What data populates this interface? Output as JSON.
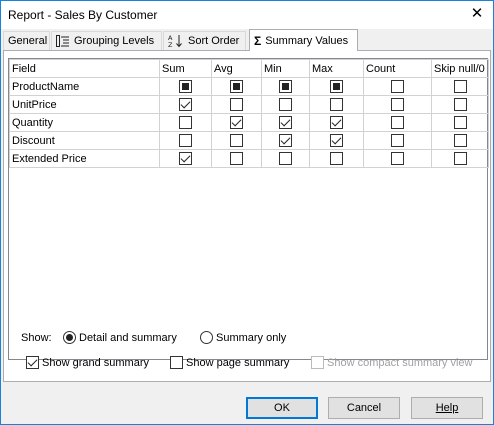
{
  "window": {
    "title": "Report - Sales By Customer",
    "close_glyph": "✕"
  },
  "tabs": [
    {
      "label": "General",
      "icon": ""
    },
    {
      "label": "Grouping Levels",
      "icon": "grouping-levels-icon"
    },
    {
      "label": "Sort Order",
      "icon": "sort-az-icon"
    },
    {
      "label": "Summary Values",
      "icon": "sigma-icon",
      "active": true
    }
  ],
  "grid": {
    "columns": [
      "Field",
      "Sum",
      "Avg",
      "Min",
      "Max",
      "Count",
      "Skip null/0"
    ],
    "rows": [
      {
        "field": "ProductName",
        "values": [
          "indeterminate",
          "indeterminate",
          "indeterminate",
          "indeterminate",
          "unchecked",
          "unchecked"
        ]
      },
      {
        "field": "UnitPrice",
        "values": [
          "checked",
          "unchecked",
          "unchecked",
          "unchecked",
          "unchecked",
          "unchecked"
        ]
      },
      {
        "field": "Quantity",
        "values": [
          "unchecked",
          "checked",
          "checked",
          "checked",
          "unchecked",
          "unchecked"
        ]
      },
      {
        "field": "Discount",
        "values": [
          "unchecked",
          "unchecked",
          "checked",
          "checked",
          "unchecked",
          "unchecked"
        ]
      },
      {
        "field": "Extended Price",
        "values": [
          "checked",
          "unchecked",
          "unchecked",
          "unchecked",
          "unchecked",
          "unchecked"
        ]
      }
    ]
  },
  "show": {
    "label": "Show:",
    "options": [
      {
        "label": "Detail and summary",
        "selected": true
      },
      {
        "label": "Summary only",
        "selected": false
      }
    ]
  },
  "checkboxes": [
    {
      "label": "Show grand summary",
      "checked": true,
      "enabled": true
    },
    {
      "label": "Show page summary",
      "checked": false,
      "enabled": true
    },
    {
      "label": "Show compact summary view",
      "checked": false,
      "enabled": false
    }
  ],
  "buttons": {
    "ok": "OK",
    "cancel": "Cancel",
    "help": "Help"
  },
  "colors": {
    "accent": "#0078d7",
    "window_border": "#1883d7"
  }
}
